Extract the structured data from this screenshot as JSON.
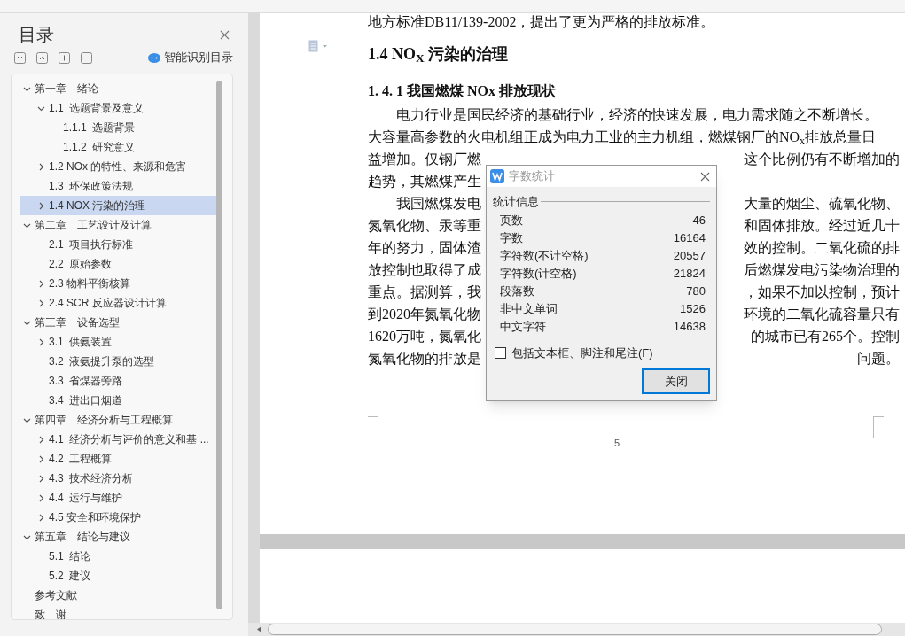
{
  "toc": {
    "title": "目录",
    "smart_button": "智能识别目录",
    "items": [
      {
        "label": "第一章　绪论",
        "expanded": true,
        "selected": false,
        "children": [
          {
            "label": "1.1  选题背景及意义",
            "expanded": true,
            "selected": false,
            "children": [
              {
                "label": "1.1.1  选题背景",
                "selected": false
              },
              {
                "label": "1.1.2  研究意义",
                "selected": false
              }
            ]
          },
          {
            "label": "1.2 NOx 的特性、来源和危害",
            "expanded": false,
            "selected": false
          },
          {
            "label": "1.3  环保政策法规",
            "selected": false
          },
          {
            "label": "1.4 NOX 污染的治理",
            "expanded": false,
            "selected": true
          }
        ]
      },
      {
        "label": "第二章　工艺设计及计算",
        "expanded": true,
        "selected": false,
        "children": [
          {
            "label": "2.1  项目执行标准",
            "selected": false
          },
          {
            "label": "2.2  原始参数",
            "selected": false
          },
          {
            "label": "2.3 物料平衡核算",
            "expanded": false,
            "selected": false
          },
          {
            "label": "2.4 SCR 反应器设计计算",
            "expanded": false,
            "selected": false
          }
        ]
      },
      {
        "label": "第三章　设备选型",
        "expanded": true,
        "selected": false,
        "children": [
          {
            "label": "3.1  供氨装置",
            "expanded": false,
            "selected": false
          },
          {
            "label": "3.2  液氨提升泵的选型",
            "selected": false
          },
          {
            "label": "3.3  省煤器旁路",
            "selected": false
          },
          {
            "label": "3.4  进出口烟道",
            "selected": false
          }
        ]
      },
      {
        "label": "第四章　经济分析与工程概算",
        "expanded": true,
        "selected": false,
        "children": [
          {
            "label": "4.1  经济分析与评价的意义和基 ...",
            "expanded": false,
            "selected": false
          },
          {
            "label": "4.2  工程概算",
            "expanded": false,
            "selected": false
          },
          {
            "label": "4.3  技术经济分析",
            "expanded": false,
            "selected": false
          },
          {
            "label": "4.4  运行与维护",
            "expanded": false,
            "selected": false
          },
          {
            "label": "4.5 安全和环境保护",
            "expanded": false,
            "selected": false
          }
        ]
      },
      {
        "label": "第五章　结论与建议",
        "expanded": true,
        "selected": false,
        "children": [
          {
            "label": "5.1  结论",
            "selected": false
          },
          {
            "label": "5.2  建议",
            "selected": false
          }
        ]
      },
      {
        "label": "参考文献",
        "selected": false
      },
      {
        "label": "致　谢",
        "selected": false
      }
    ]
  },
  "document": {
    "top_line": "地方标准DB11/139-2002，提出了更为严格的排放标准。",
    "heading": "1.4 NO$_{X}$ 污染的治理",
    "subheading": "1. 4. 1  我国燃煤 NOx 排放现状",
    "lines": [
      {
        "left": "　　电力行业是国民经济的基础行业，经济的快速发展，电力需求随之不断增长。"
      },
      {
        "left": "大容量高参数的火电机组正成为电力工业的主力机组，燃煤钢厂的NO$_{x}$排放总量日"
      },
      {
        "left": "益增加。仅钢厂燃",
        "right": "这个比例仍有不断增加的"
      },
      {
        "left": "趋势，其燃煤产生"
      },
      {
        "left": "　　我国燃煤发电",
        "right": "大量的烟尘、硫氧化物、"
      },
      {
        "left": "氮氧化物、汞等重",
        "right": "和固体排放。经过近几十"
      },
      {
        "left": "年的努力，固体渣",
        "right": "效的控制。二氧化硫的排"
      },
      {
        "left": "放控制也取得了成",
        "right": "后燃煤发电污染物治理的"
      },
      {
        "left": "重点。据测算，我",
        "right": "，如果不加以控制，预计"
      },
      {
        "left": "到2020年氮氧化物",
        "right": "环境的二氧化硫容量只有"
      },
      {
        "left": "1620万吨，氮氧化",
        "right": "的城市已有265个。控制"
      },
      {
        "left": "氮氧化物的排放是",
        "right": "问题。"
      }
    ],
    "page_number": "5"
  },
  "dialog": {
    "title": "字数统计",
    "group": "统计信息",
    "stats": [
      {
        "label": "页数",
        "value": "46"
      },
      {
        "label": "字数",
        "value": "16164"
      },
      {
        "label": "字符数(不计空格)",
        "value": "20557"
      },
      {
        "label": "字符数(计空格)",
        "value": "21824"
      },
      {
        "label": "段落数",
        "value": "780"
      },
      {
        "label": "非中文单词",
        "value": "1526"
      },
      {
        "label": "中文字符",
        "value": "14638"
      }
    ],
    "checkbox": {
      "label": "包括文本框、脚注和尾注(F)",
      "checked": false
    },
    "button": "关闭"
  }
}
